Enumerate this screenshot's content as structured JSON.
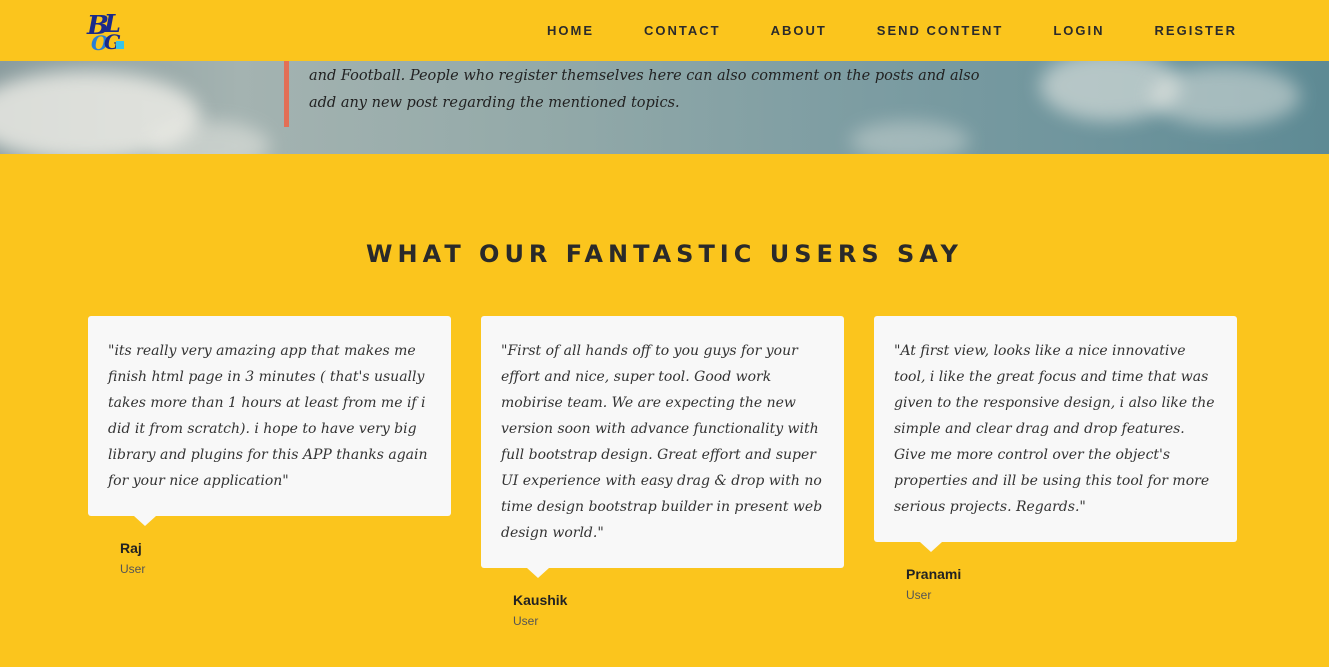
{
  "navbar": {
    "logo_text": "BLOG",
    "items": [
      {
        "label": "HOME"
      },
      {
        "label": "CONTACT"
      },
      {
        "label": "ABOUT"
      },
      {
        "label": "SEND CONTENT"
      },
      {
        "label": "LOGIN"
      },
      {
        "label": "REGISTER"
      }
    ]
  },
  "hero": {
    "text": "and Football. People who register themselves here can also comment on the posts and also add any new post regarding the mentioned topics."
  },
  "testimonials_section": {
    "title": "WHAT OUR FANTASTIC USERS SAY",
    "items": [
      {
        "quote": "\"its really very amazing app that makes me finish html page in 3 minutes ( that's usually takes more than 1 hours at least from me if i did it from scratch). i hope to have very big library and plugins for this APP thanks again for your nice application\"",
        "name": "Raj",
        "role": "User"
      },
      {
        "quote": "\"First of all hands off to you guys for your effort and nice, super tool. Good work mobirise team. We are expecting the new version soon with advance functionality with full bootstrap design. Great effort and super UI experience with easy drag & drop with no time design bootstrap builder in present web design world.\"",
        "name": "Kaushik",
        "role": "User"
      },
      {
        "quote": "\"At first view, looks like a nice innovative tool, i like the great focus and time that was given to the responsive design, i also like the simple and clear drag and drop features. Give me more control over the object's properties and ill be using this tool for more serious projects. Regards.\"",
        "name": "Pranami",
        "role": "User"
      }
    ]
  },
  "colors": {
    "background": "#fbc51d",
    "accent_bar": "#e36f56",
    "card": "#f8f8f8",
    "text": "#2a2a2a"
  }
}
